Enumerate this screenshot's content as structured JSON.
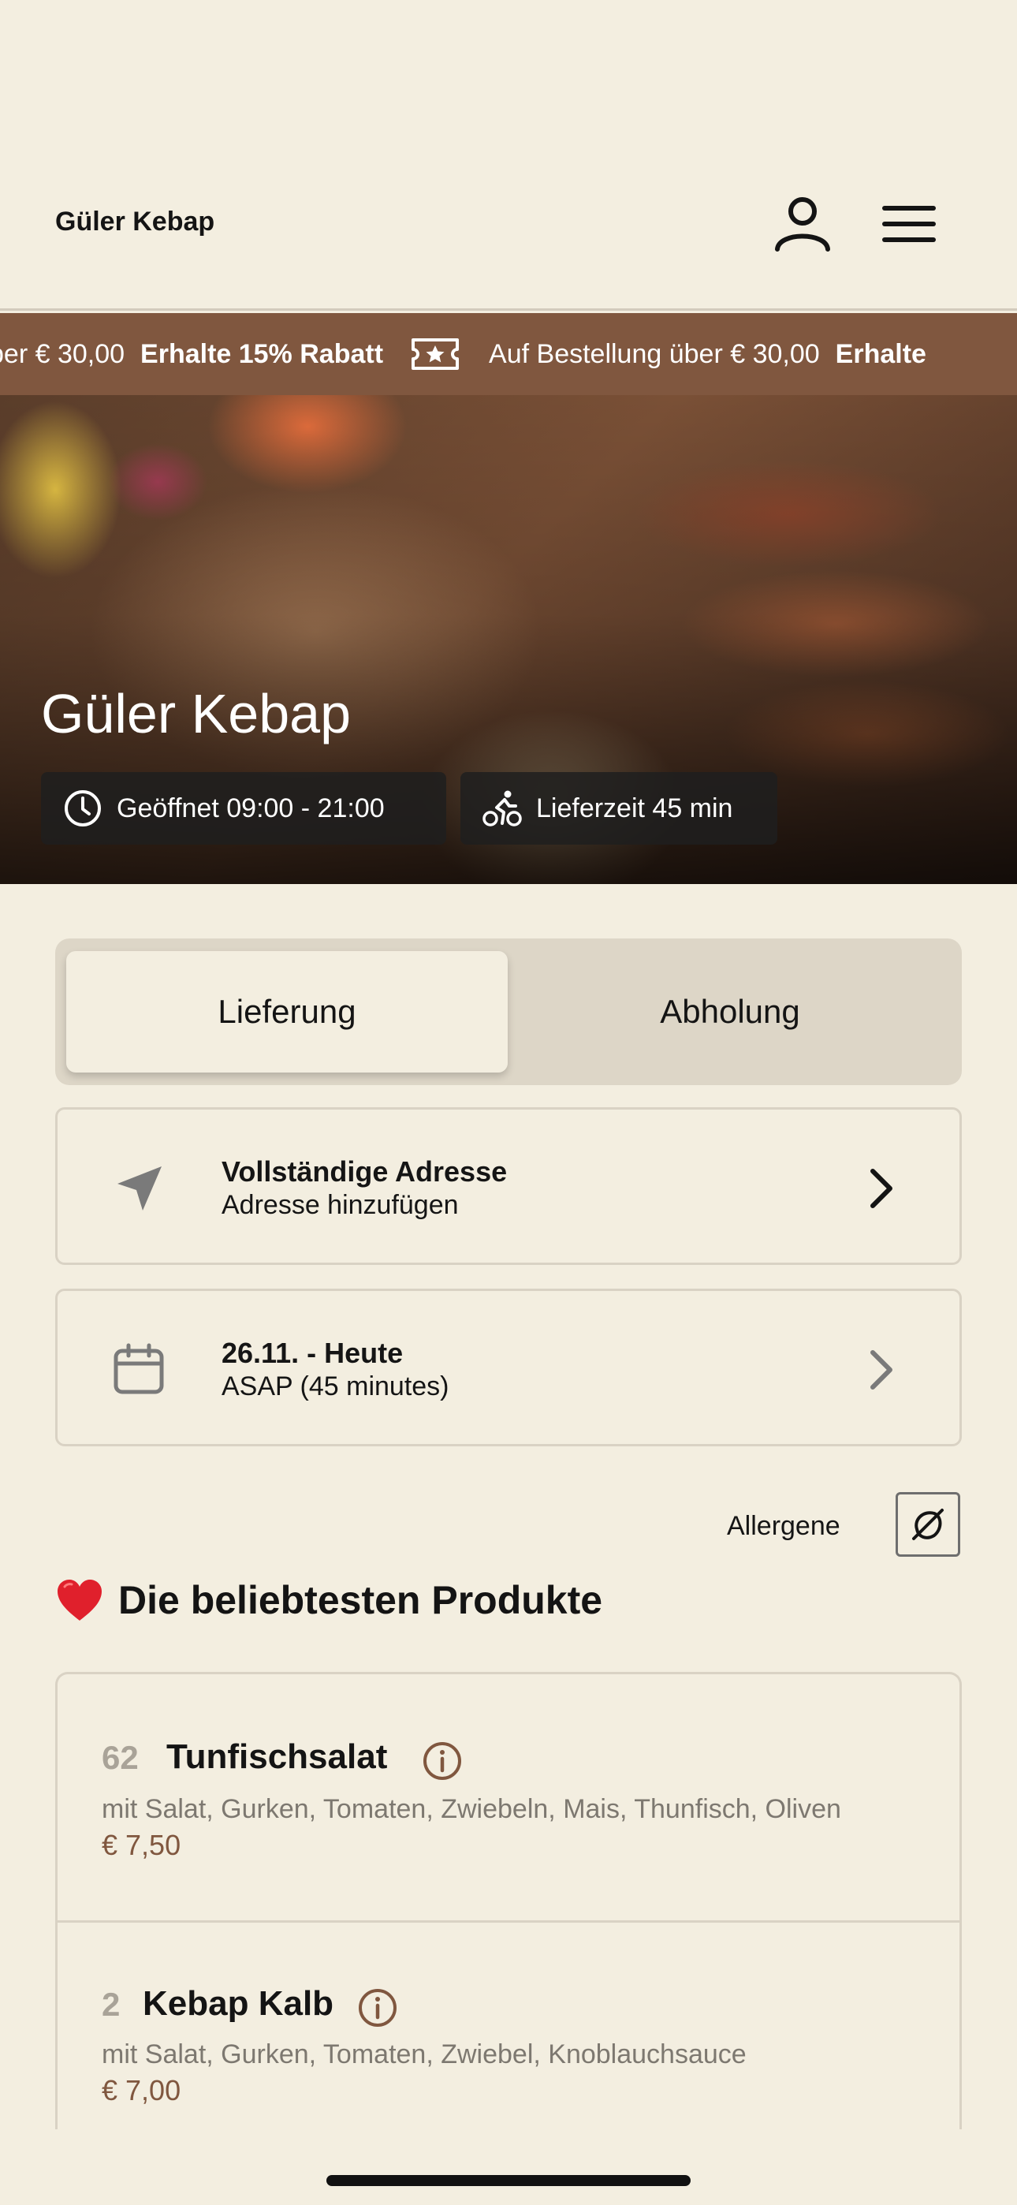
{
  "header": {
    "brand": "Güler Kebap",
    "icons": [
      "user-icon",
      "menu-icon"
    ]
  },
  "promo": {
    "segment1_normal": "ber € 30,00",
    "segment1_bold": "Erhalte 15% Rabatt",
    "segment2_normal": "Auf Bestellung über € 30,00",
    "segment2_bold": "Erhalte",
    "icon": "ticket-star-icon"
  },
  "hero": {
    "title": "Güler Kebap",
    "opening_hours": "Geöffnet 09:00 - 21:00",
    "delivery_time": "Lieferzeit 45 min"
  },
  "order_mode": {
    "tabs": [
      "Lieferung",
      "Abholung"
    ],
    "selected": "Lieferung"
  },
  "address_card": {
    "title": "Vollständige Adresse",
    "subtitle": "Adresse hinzufügen",
    "icon": "location-arrow-icon"
  },
  "time_card": {
    "title": "26.11. - Heute",
    "subtitle": "ASAP (45 minutes)",
    "icon": "calendar-icon"
  },
  "allergens": {
    "label": "Allergene",
    "icon": "allergen-icon"
  },
  "popular": {
    "emoji": "❤️",
    "title": "Die beliebtesten Produkte",
    "products": [
      {
        "number": "62",
        "name": "Tunfischsalat",
        "description": "mit Salat, Gurken, Tomaten, Zwiebeln, Mais, Thunfisch, Oliven",
        "price": "€ 7,50"
      },
      {
        "number": "2",
        "name": "Kebap Kalb",
        "description": "mit Salat, Gurken, Tomaten, Zwiebel, Knoblauchsauce",
        "price": "€ 7,00"
      }
    ]
  },
  "colors": {
    "background": "#f3eee0",
    "accent_brown": "#80573f",
    "card_border": "#d9d2c4",
    "toggle_bg": "#ddd6c7"
  }
}
